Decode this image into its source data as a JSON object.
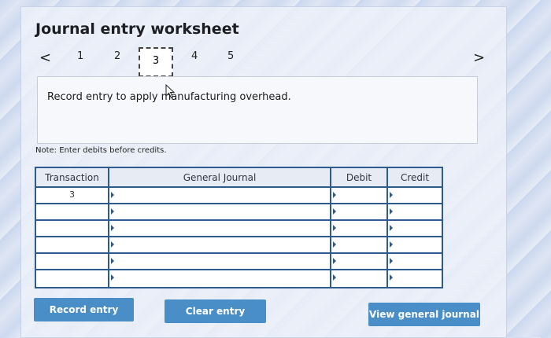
{
  "title": "Journal entry worksheet",
  "nav": {
    "prev": "<",
    "next": ">",
    "tabs": [
      "1",
      "2",
      "3",
      "4",
      "5"
    ]
  },
  "instruction": "Record entry to apply manufacturing overhead.",
  "note": "Note: Enter debits before credits.",
  "table": {
    "headers": [
      "Transaction",
      "General Journal",
      "Debit",
      "Credit"
    ],
    "rows": [
      {
        "transaction": "3",
        "account": "",
        "debit": "",
        "credit": ""
      },
      {
        "transaction": "",
        "account": "",
        "debit": "",
        "credit": ""
      },
      {
        "transaction": "",
        "account": "",
        "debit": "",
        "credit": ""
      },
      {
        "transaction": "",
        "account": "",
        "debit": "",
        "credit": ""
      },
      {
        "transaction": "",
        "account": "",
        "debit": "",
        "credit": ""
      },
      {
        "transaction": "",
        "account": "",
        "debit": "",
        "credit": ""
      }
    ]
  },
  "buttons": {
    "record": "Record entry",
    "clear": "Clear entry",
    "view": "View general journal"
  }
}
